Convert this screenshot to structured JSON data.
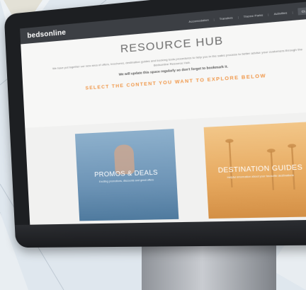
{
  "site": {
    "logo": "bedsonline"
  },
  "nav": {
    "links": [
      "Accomodation",
      "Transfers",
      "Theme Parks",
      "Activities"
    ],
    "button": "CLIENT LOGIN"
  },
  "hero": {
    "title": "RESOURCE HUB",
    "paragraph": "We have put together our new area of offers, brochures, destination guides and booking tools procedures to help you in the sales process to better advise your customers through the Bedsonline Resource Hub.",
    "bold_line": "We will update this space regularly so don't forget to bookmark it.",
    "cta": "SELECT THE CONTENT YOU WANT TO EXPLORE BELOW"
  },
  "cards": [
    {
      "title": "PROMOS & DEALS",
      "subtitle": "Exciting promotions, discounts and great offers"
    },
    {
      "title": "DESTINATION GUIDES",
      "subtitle": "Helpful information about your favourite destinations"
    }
  ],
  "colors": {
    "accent": "#f0984a",
    "nav_bg": "#3c3f44"
  }
}
